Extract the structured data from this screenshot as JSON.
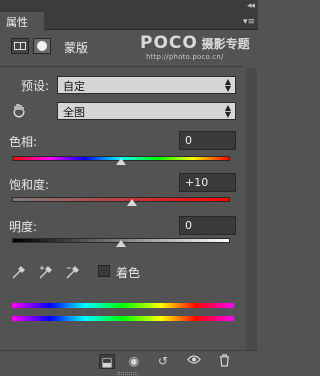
{
  "panel": {
    "tab_label": "属性",
    "collapse_glyph": "◂◂",
    "menu_glyph": "▾≡"
  },
  "header": {
    "mask_label": "蒙版",
    "watermark": {
      "brand": "POCO",
      "chinese": "摄影专题",
      "url": "http://photo.poco.cn/"
    }
  },
  "preset": {
    "label": "预设:",
    "value": "自定"
  },
  "channel": {
    "value": "全图"
  },
  "hue": {
    "label": "色相:",
    "value": "0",
    "fraction": 0.5
  },
  "saturation": {
    "label": "饱和度:",
    "value": "+10",
    "fraction": 0.55
  },
  "lightness": {
    "label": "明度:",
    "value": "0",
    "fraction": 0.5
  },
  "colorize": {
    "label": "着色",
    "checked": false
  },
  "arrows": {
    "up": "▲",
    "down": "▼"
  },
  "icons": {
    "clip": "⬓",
    "eye": "◉",
    "reset": "↺",
    "visibility": "👁",
    "trash": "🗑"
  },
  "colors": {
    "panel_bg": "#535353",
    "titlebar_bg": "#3c3c3c",
    "field_bg": "#3a3a3a",
    "select_bg": "#d6d6d6"
  }
}
